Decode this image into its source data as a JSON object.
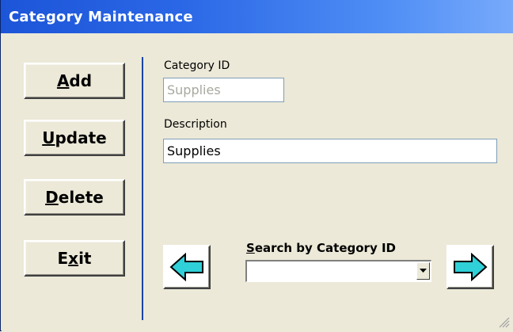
{
  "window": {
    "title": "Category Maintenance"
  },
  "buttons": {
    "add": {
      "mnemonic": "A",
      "rest": "dd"
    },
    "update": {
      "mnemonic": "U",
      "rest": "pdate"
    },
    "delete": {
      "mnemonic": "D",
      "rest": "elete"
    },
    "exit": {
      "before": "E",
      "mnemonic": "x",
      "rest": "it"
    }
  },
  "form": {
    "category_id_label": "Category ID",
    "category_id_value": "Supplies",
    "description_label": "Description",
    "description_value": "Supplies"
  },
  "search": {
    "label_mnemonic": "S",
    "label_rest": "earch by Category ID",
    "selected_value": ""
  },
  "icons": {
    "prev": "left-arrow-icon",
    "next": "right-arrow-icon",
    "dropdown": "chevron-down-icon",
    "grip": "resize-grip-icon"
  },
  "colors": {
    "titlebar": "#1d55d8",
    "arrow_fill": "#2fd0d8",
    "separator": "#1b45a4"
  }
}
